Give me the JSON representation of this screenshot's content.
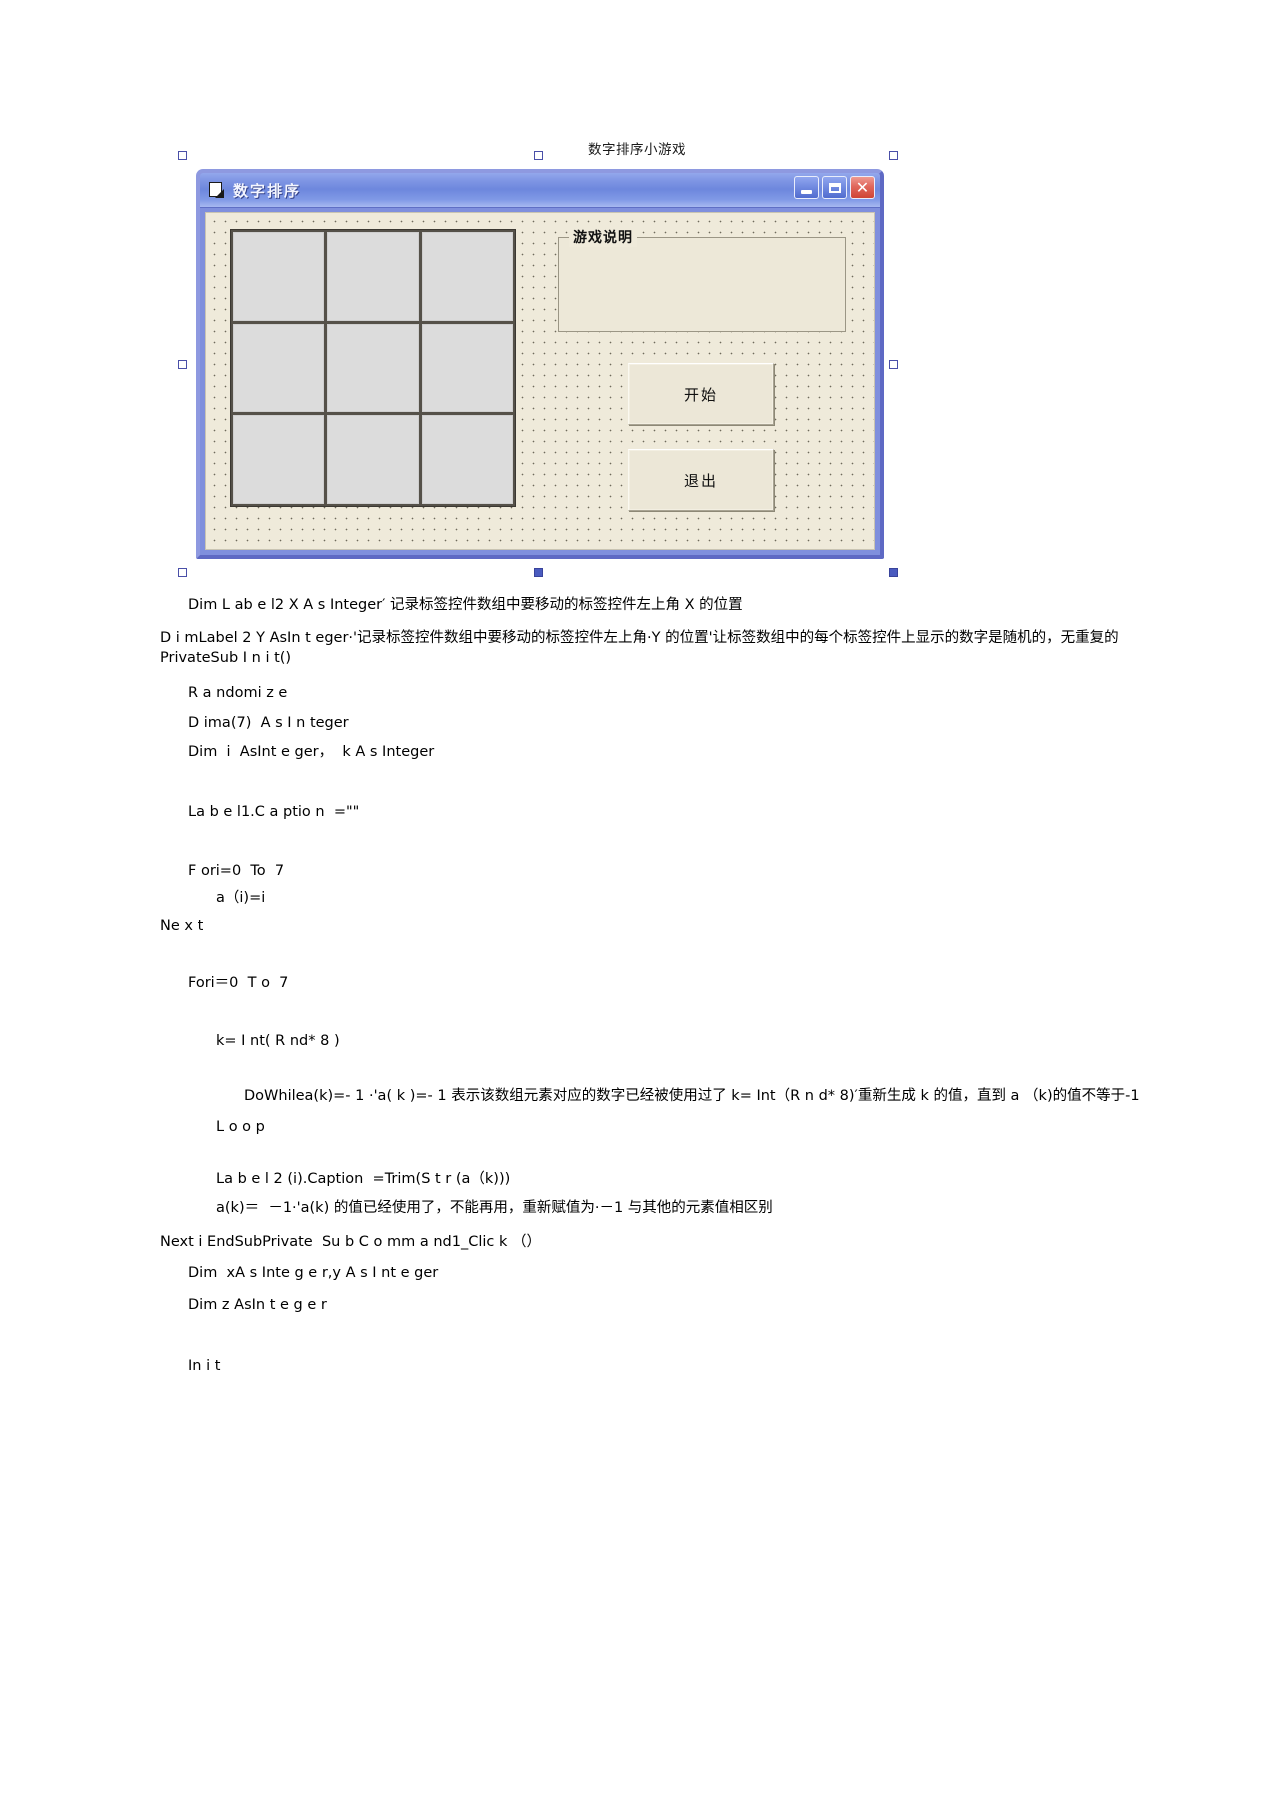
{
  "document": {
    "caption": "数字排序小游戏"
  },
  "vb_form": {
    "window_title": "数字排序",
    "title_icon": "form-document-icon",
    "buttons": {
      "minimize": "−",
      "maximize": "□",
      "close": "✕"
    },
    "grid": {
      "name": "Label2 控件数组",
      "rows": 3,
      "cols": 3,
      "cells": [
        "",
        "",
        "",
        "",
        "",
        "",
        "",
        "",
        ""
      ]
    },
    "frame": {
      "caption": "游戏说明",
      "body_text": ""
    },
    "commands": [
      {
        "name": "command1",
        "label": "开始"
      },
      {
        "name": "command2",
        "label": "退出"
      }
    ]
  },
  "code": {
    "lines": [
      {
        "text": "Dim L ab e l2 X A s Integer′ 记录标签控件数组中要移动的标签控件左上角 X 的位置",
        "indent": 1,
        "wrap": false,
        "gap": 0
      },
      {
        "text": "D i mLabel 2 Y AsIn t eger·'记录标签控件数组中要移动的标签控件左上角·Y 的位置'让标签数组中的每个标签控件上显示的数字是随机的，无重复的 PrivateSub I n i t()",
        "indent": 0,
        "wrap": true,
        "gap": 14
      },
      {
        "text": "R a ndomi z e",
        "indent": 1,
        "wrap": false,
        "gap": 16
      },
      {
        "text": "D ima(7)  A s I n teger",
        "indent": 1,
        "wrap": false,
        "gap": 10
      },
      {
        "text": "Dim  i  AsInt e ger，  k A s Integer",
        "indent": 1,
        "wrap": false,
        "gap": 10
      },
      {
        "text": "La b e l1.C a ptio n  =\"\"",
        "indent": 1,
        "wrap": false,
        "gap": 40
      },
      {
        "text": "F ori=0  To  7",
        "indent": 1,
        "wrap": false,
        "gap": 40
      },
      {
        "text": "a（i)=i",
        "indent": 2,
        "wrap": false,
        "gap": 8
      },
      {
        "text": "Ne x t",
        "indent": 0,
        "wrap": false,
        "gap": 8
      },
      {
        "text": "Fori＝0  T o  7",
        "indent": 1,
        "wrap": false,
        "gap": 38
      },
      {
        "text": "k= I nt( R nd* 8 )",
        "indent": 2,
        "wrap": false,
        "gap": 38
      },
      {
        "text": "DoWhilea(k)=- 1 ·'a( k )=- 1 表示该数组元素对应的数字已经被使用过了 k=  Int（R n d*  8)′重新生成 k 的值，直到 a （k)的值不等于-1",
        "indent": 3,
        "wrap": true,
        "gap": 36
      },
      {
        "text": "L o o p",
        "indent": 2,
        "wrap": false,
        "gap": 12
      },
      {
        "text": "La b e l 2 (i).Caption  =Trim(S t r (a（k)))",
        "indent": 2,
        "wrap": false,
        "gap": 32
      },
      {
        "text": "a(k)＝  －1·'a(k) 的值已经使用了，不能再用，重新赋值为·－1 与其他的元素值相区别",
        "indent": 2,
        "wrap": false,
        "gap": 10
      },
      {
        "text": "Next i EndSubPrivate  Su b C o mm a nd1_Clic k （）",
        "indent": 0,
        "wrap": false,
        "gap": 14
      },
      {
        "text": "Dim  xA s Inte g e r,y A s I nt e ger",
        "indent": 1,
        "wrap": false,
        "gap": 12
      },
      {
        "text": "Dim z AsIn t e g e r",
        "indent": 1,
        "wrap": false,
        "gap": 12
      },
      {
        "text": "In i t",
        "indent": 1,
        "wrap": false,
        "gap": 42
      }
    ]
  }
}
